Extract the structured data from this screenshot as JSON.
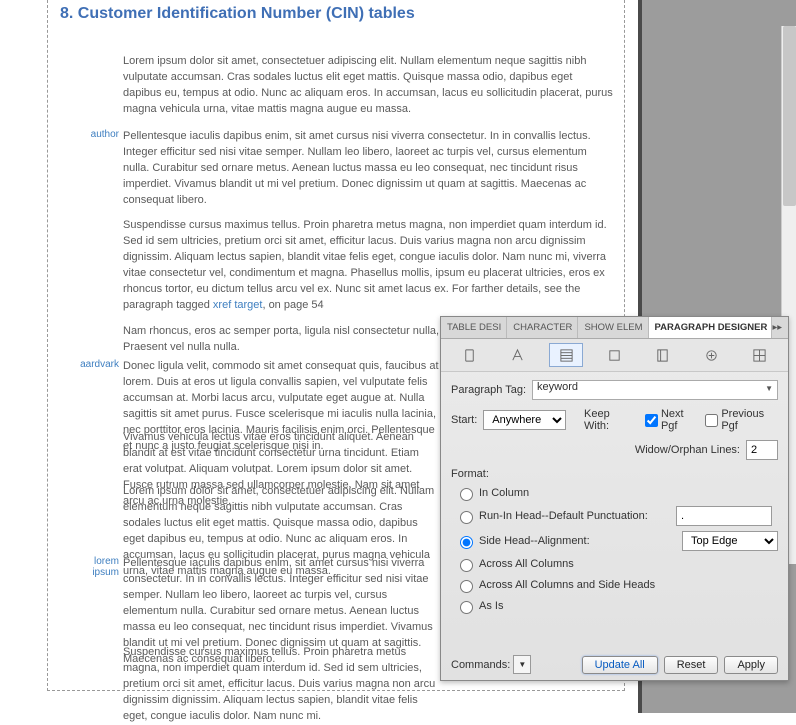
{
  "heading": "8. Customer Identification Number (CIN) tables",
  "paragraphs": {
    "p1": "Lorem ipsum dolor sit amet, consectetuer adipiscing elit. Nullam elementum neque sagittis nibh vulputate accumsan. Cras sodales luctus elit eget mattis. Quisque massa odio, dapibus eget dapibus eu, tempus at odio. Nunc ac aliquam eros. In accumsan, lacus eu sollicitudin placerat, purus magna vehicula urna, vitae mattis magna augue eu massa.",
    "p2": "Pellentesque iaculis dapibus enim, sit amet cursus nisi viverra consectetur. In in convallis lectus. Integer efficitur sed nisi vitae semper. Nullam leo libero, laoreet ac turpis vel, cursus elementum nulla. Curabitur sed ornare metus. Aenean luctus massa eu leo consequat, nec tincidunt risus imperdiet. Vivamus blandit ut mi vel pretium. Donec dignissim ut quam at sagittis. Maecenas ac consequat libero.",
    "p3_a": "Suspendisse cursus maximus tellus. Proin pharetra metus magna, non imperdiet quam interdum id. Sed id sem ultricies, pretium orci sit amet, efficitur lacus. Duis varius magna non arcu dignissim dignissim. Aliquam lectus sapien, blandit vitae felis eget, congue iaculis dolor. Nam nunc mi, viverra vitae consectetur vel, condimentum et magna. Phasellus mollis, ipsum eu placerat ultricies, eros ex rhoncus tortor, eu dictum tellus arcu vel ex. Nunc sit amet lacus ex. For farther details, see the paragraph tagged ",
    "xref": "xref target",
    "p3_b": ", on page 54",
    "p4": "Nam rhoncus, eros ac semper porta, ligula nisl consectetur nulla, sed consectetur enim arcu et elit. Praesent vel nulla nulla.",
    "p5": "Donec ligula velit, commodo sit amet consequat quis, faucibus at lorem. Duis at eros ut ligula convallis sapien, vel vulputate felis accumsan at. Morbi lacus arcu, vulputate eget augue at. Nulla sagittis sit amet purus. Fusce scelerisque mi iaculis nulla lacinia, nec porttitor eros lacinia. Mauris facilisis enim orci. Pellentesque et nunc a justo feugiat scelerisque nisi in.",
    "p6": "Vivamus vehicula lectus vitae eros tincidunt aliquet. Aenean blandit at est vitae tincidunt consectetur urna tincidunt. Etiam erat volutpat. Aliquam volutpat. Lorem ipsum dolor sit amet. Fusce rutrum massa sed ullamcorper molestie. Nam sit amet arcu ac urna molestie.",
    "p7": "Lorem ipsum dolor sit amet, consectetuer adipiscing elit. Nullam elementum neque sagittis nibh vulputate accumsan. Cras sodales luctus elit eget mattis. Quisque massa odio, dapibus eget dapibus eu, tempus at odio. Nunc ac aliquam eros. In accumsan, lacus eu sollicitudin placerat, purus magna vehicula urna, vitae mattis magna augue eu massa.",
    "p8": "Pellentesque iaculis dapibus enim, sit amet cursus nisi viverra consectetur. In in convallis lectus. Integer efficitur sed nisi vitae semper. Nullam leo libero, laoreet ac turpis vel, cursus elementum nulla. Curabitur sed ornare metus. Aenean luctus massa eu leo consequat, nec tincidunt risus imperdiet. Vivamus blandit ut mi vel pretium. Donec dignissim ut quam at sagittis. Maecenas ac consequat libero.",
    "p9": "Suspendisse cursus maximus tellus. Proin pharetra metus magna, non imperdiet quam interdum id. Sed id sem ultricies, pretium orci sit amet, efficitur lacus. Duis varius magna non arcu dignissim dignissim. Aliquam lectus sapien, blandit vitae felis eget, congue iaculis dolor. Nam nunc mi."
  },
  "margin": {
    "author": "author",
    "aardvark": "aardvark",
    "lorem": "lorem\nipsum"
  },
  "panel": {
    "tabs": [
      "TABLE DESI",
      "CHARACTER",
      "SHOW ELEM",
      "PARAGRAPH DESIGNER"
    ],
    "paragraph_tag_label": "Paragraph Tag:",
    "paragraph_tag_value": "keyword",
    "start_label": "Start:",
    "start_value": "Anywhere",
    "keep_with_label": "Keep With:",
    "next_pgf": "Next Pgf",
    "prev_pgf": "Previous Pgf",
    "widow_label": "Widow/Orphan Lines:",
    "widow_value": "2",
    "format_label": "Format:",
    "radios": {
      "in_column": "In Column",
      "runin": "Run-In Head--Default Punctuation:",
      "runin_value": ".",
      "sidehead": "Side Head--Alignment:",
      "sidehead_value": "Top Edge",
      "across_all": "Across All Columns",
      "across_side": "Across All Columns and Side Heads",
      "as_is": "As Is"
    },
    "commands_label": "Commands:",
    "buttons": {
      "update": "Update All",
      "reset": "Reset",
      "apply": "Apply"
    }
  }
}
